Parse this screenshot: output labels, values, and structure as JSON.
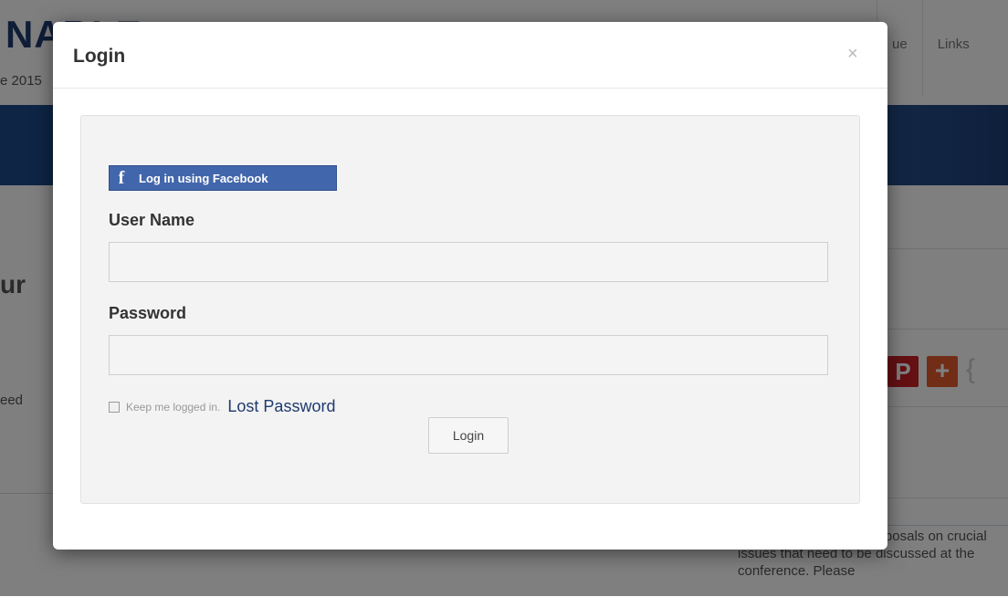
{
  "background": {
    "logo_text": "NABLE",
    "date_text": "e 2015",
    "nav": [
      "ue",
      "Links"
    ],
    "heading_fragment": "ur",
    "text_fragment": "eed",
    "side_text": "Hear your ideas and proposals on crucial issues that need to be discussed at the conference. Please",
    "share_icons": [
      "pinterest-icon",
      "plus-icon"
    ],
    "colors": {
      "banner": "#22508f",
      "pinterest": "#cb2027",
      "plus": "#e55b2d"
    }
  },
  "modal": {
    "title": "Login",
    "close_symbol": "×",
    "facebook": {
      "icon": "f",
      "label": "Log in using Facebook",
      "color": "#4266ab"
    },
    "username": {
      "label": "User Name",
      "value": "",
      "placeholder": ""
    },
    "password": {
      "label": "Password",
      "value": "",
      "placeholder": ""
    },
    "remember_label": "Keep me logged in.",
    "lost_password": "Lost Password",
    "login_button": "Login"
  }
}
